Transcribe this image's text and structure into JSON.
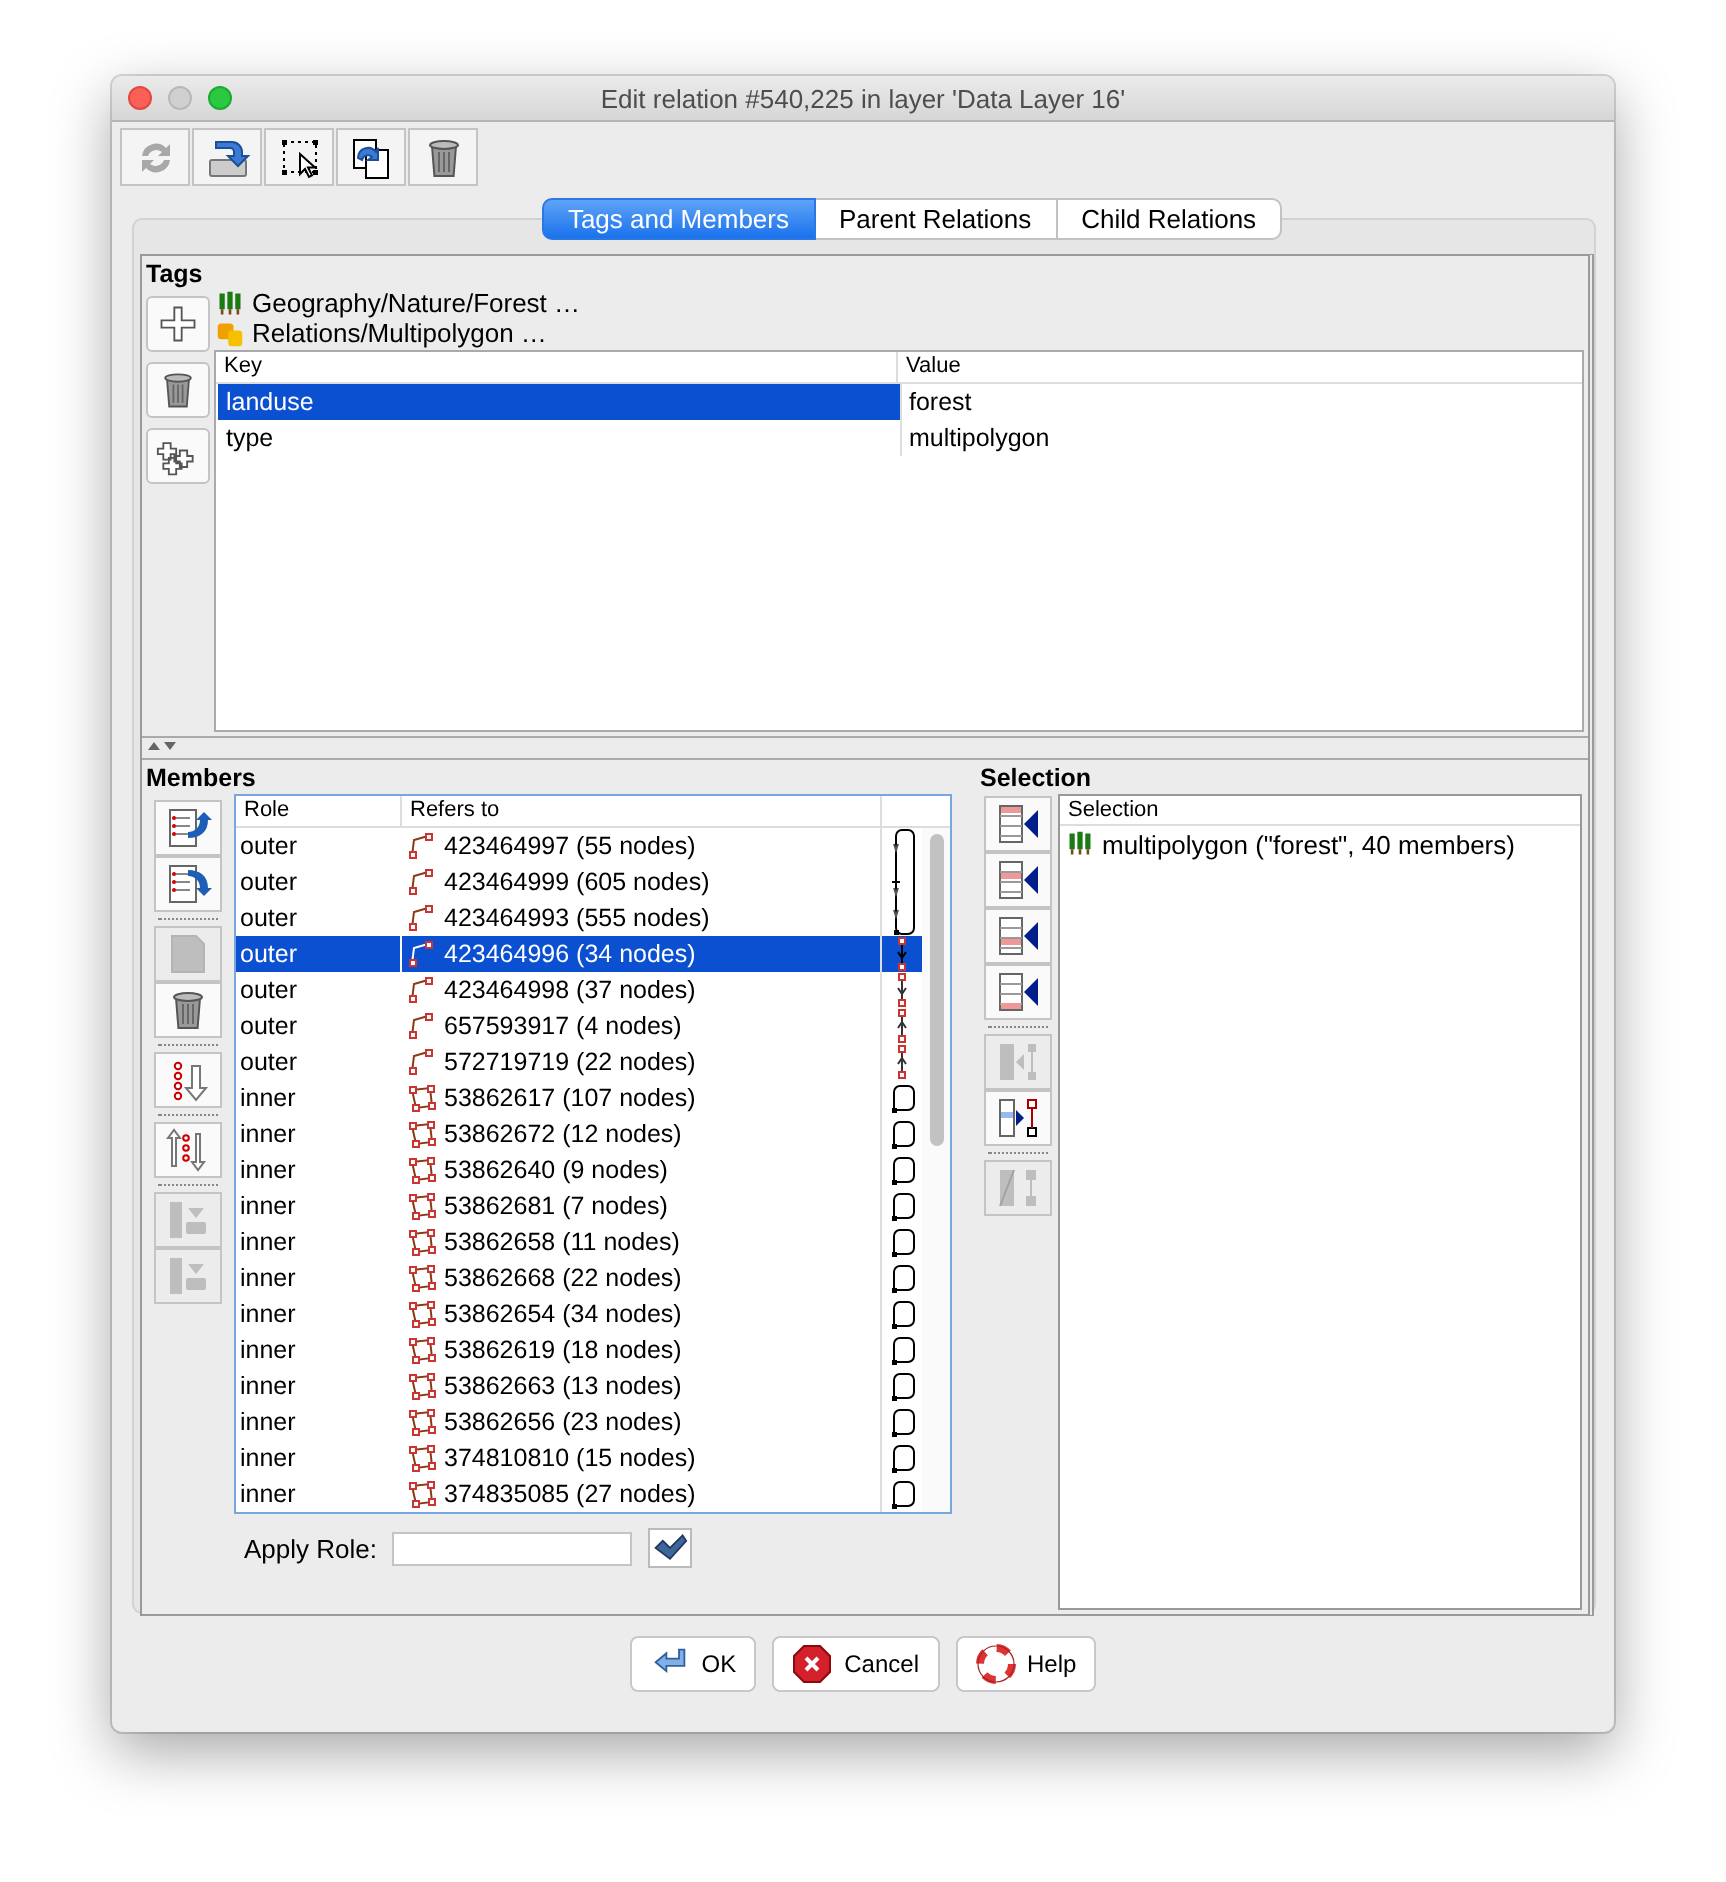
{
  "window": {
    "title": "Edit relation #540,225 in layer 'Data Layer 16'"
  },
  "toolbar": [
    {
      "disabled": true
    },
    {
      "disabled": false
    },
    {
      "disabled": false
    },
    {
      "disabled": false
    },
    {
      "disabled": false
    }
  ],
  "tabs": [
    {
      "label": "Tags and Members",
      "selected": true
    },
    {
      "label": "Parent Relations",
      "selected": false
    },
    {
      "label": "Child Relations",
      "selected": false
    }
  ],
  "tags": {
    "title": "Tags",
    "buttons": [
      {
        "disabled": false
      },
      {
        "disabled": false
      },
      {
        "disabled": false
      }
    ],
    "presets": [
      {
        "kind": "forest",
        "label": "Geography/Nature/Forest …"
      },
      {
        "kind": "relation",
        "label": "Relations/Multipolygon …"
      }
    ],
    "columns": [
      "Key",
      "Value"
    ],
    "rows": [
      {
        "key": "landuse",
        "value": "forest",
        "selected": true
      },
      {
        "key": "type",
        "value": "multipolygon",
        "selected": false
      }
    ]
  },
  "members": {
    "title": "Members",
    "button_groups": [
      [
        {
          "disabled": false
        },
        {
          "disabled": false
        }
      ],
      [
        {
          "disabled": true
        },
        {
          "disabled": false
        }
      ],
      [
        {
          "disabled": false
        }
      ],
      [
        {
          "disabled": false
        }
      ],
      [
        {
          "disabled": true
        },
        {
          "disabled": true
        }
      ]
    ],
    "columns": [
      "Role",
      "Refers to"
    ],
    "rows": [
      {
        "role": "outer",
        "ref": "423464997 (55 nodes)",
        "kind": "way-top",
        "selected": false
      },
      {
        "role": "outer",
        "ref": "423464999 (605 nodes)",
        "kind": "way-middle",
        "selected": false
      },
      {
        "role": "outer",
        "ref": "423464993 (555 nodes)",
        "kind": "way-bottom",
        "selected": false
      },
      {
        "role": "outer",
        "ref": "423464996 (34 nodes)",
        "kind": "way-down",
        "selected": true
      },
      {
        "role": "outer",
        "ref": "423464998 (37 nodes)",
        "kind": "way-down",
        "selected": false
      },
      {
        "role": "outer",
        "ref": "657593917 (4 nodes)",
        "kind": "way-up",
        "selected": false
      },
      {
        "role": "outer",
        "ref": "572719719 (22 nodes)",
        "kind": "way-up",
        "selected": false
      },
      {
        "role": "inner",
        "ref": "53862617 (107 nodes)",
        "kind": "area-closed",
        "selected": false
      },
      {
        "role": "inner",
        "ref": "53862672 (12 nodes)",
        "kind": "area-closed",
        "selected": false
      },
      {
        "role": "inner",
        "ref": "53862640 (9 nodes)",
        "kind": "area-closed",
        "selected": false
      },
      {
        "role": "inner",
        "ref": "53862681 (7 nodes)",
        "kind": "area-closed",
        "selected": false
      },
      {
        "role": "inner",
        "ref": "53862658 (11 nodes)",
        "kind": "area-closed",
        "selected": false
      },
      {
        "role": "inner",
        "ref": "53862668 (22 nodes)",
        "kind": "area-closed",
        "selected": false
      },
      {
        "role": "inner",
        "ref": "53862654 (34 nodes)",
        "kind": "area-closed",
        "selected": false
      },
      {
        "role": "inner",
        "ref": "53862619 (18 nodes)",
        "kind": "area-closed",
        "selected": false
      },
      {
        "role": "inner",
        "ref": "53862663 (13 nodes)",
        "kind": "area-closed",
        "selected": false
      },
      {
        "role": "inner",
        "ref": "53862656 (23 nodes)",
        "kind": "area-closed",
        "selected": false
      },
      {
        "role": "inner",
        "ref": "374810810 (15 nodes)",
        "kind": "area-closed",
        "selected": false
      },
      {
        "role": "inner",
        "ref": "374835085 (27 nodes)",
        "kind": "area-closed",
        "selected": false
      }
    ],
    "apply_role": {
      "label": "Apply Role:"
    }
  },
  "selection": {
    "title": "Selection",
    "button_groups": [
      [
        {
          "disabled": false
        },
        {
          "disabled": false
        },
        {
          "disabled": false
        },
        {
          "disabled": false
        }
      ],
      [
        {
          "disabled": true
        },
        {
          "disabled": false
        }
      ],
      [
        {
          "disabled": true
        }
      ]
    ],
    "column": "Selection",
    "rows": [
      {
        "kind": "forest",
        "label": "multipolygon (\"forest\", 40 members)"
      }
    ]
  },
  "buttons": [
    {
      "kind": "ok",
      "label": "OK"
    },
    {
      "kind": "cancel",
      "label": "Cancel"
    },
    {
      "kind": "help",
      "label": "Help"
    }
  ]
}
